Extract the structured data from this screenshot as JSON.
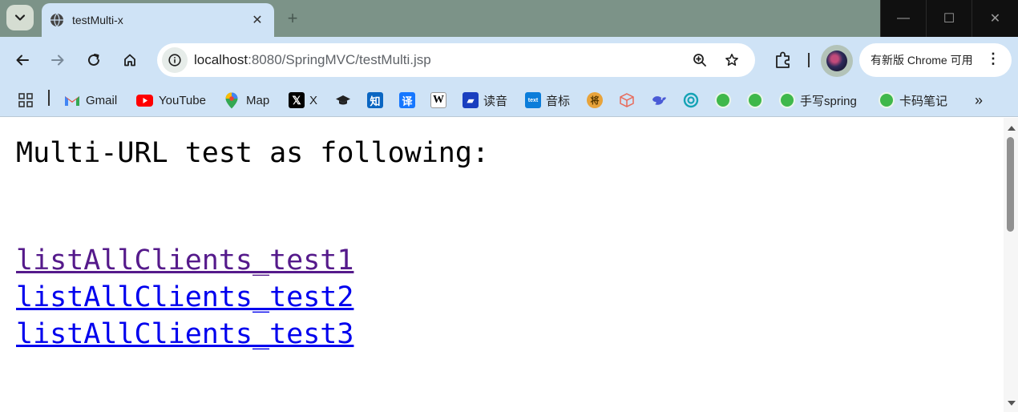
{
  "browser": {
    "tab": {
      "title": "testMulti-x",
      "close_glyph": "✕"
    },
    "new_tab_glyph": "+",
    "window_controls": {
      "minimize": "—",
      "maximize": "☐",
      "close": "✕"
    },
    "omnibox": {
      "url_host": "localhost",
      "url_rest": ":8080/SpringMVC/testMulti.jsp"
    },
    "update_chip": {
      "label": "有新版 Chrome 可用",
      "menu_glyph": "⋮"
    },
    "bookmarks": [
      {
        "label": "",
        "icon": "apps-grid-icon"
      },
      {
        "label": "Gmail",
        "icon": "gmail-icon",
        "color": "#ea4335"
      },
      {
        "label": "YouTube",
        "icon": "youtube-icon",
        "color": "#ff0000"
      },
      {
        "label": "Map",
        "icon": "maps-pin-icon",
        "color": "#34a853"
      },
      {
        "label": "X",
        "icon": "x-icon",
        "color": "#000000"
      },
      {
        "label": "",
        "icon": "graduation-cap-icon",
        "color": "#222222"
      },
      {
        "label": "",
        "icon": "zhihu-icon",
        "color": "#0a66c2"
      },
      {
        "label": "",
        "icon": "translate-icon",
        "color": "#1677ff"
      },
      {
        "label": "",
        "icon": "wikipedia-icon",
        "color": "#ffffff"
      },
      {
        "label": "读音",
        "icon": "flag-icon",
        "color": "#1a3fbf"
      },
      {
        "label": "音标",
        "icon": "textbox-icon",
        "color": "#0b7dda"
      },
      {
        "label": "",
        "icon": "coin-icon",
        "color": "#e8a33a"
      },
      {
        "label": "",
        "icon": "cube-icon",
        "color": "#e86a5a"
      },
      {
        "label": "",
        "icon": "bird-icon",
        "color": "#4a5bd6"
      },
      {
        "label": "",
        "icon": "swirl-icon",
        "color": "#15a3b5"
      },
      {
        "label": "",
        "icon": "leaf-icon",
        "color": "#3fb84a"
      },
      {
        "label": "",
        "icon": "leaf-icon",
        "color": "#3fb84a"
      },
      {
        "label": "手写spring",
        "icon": "leaf-icon",
        "color": "#3fb84a"
      },
      {
        "label": "卡码笔记",
        "icon": "leaf-icon",
        "color": "#3fb84a"
      }
    ],
    "bookmarks_overflow_glyph": "»"
  },
  "page": {
    "heading": "Multi-URL test as following:",
    "links": [
      {
        "label": "listAllClients_test1",
        "state": "visited"
      },
      {
        "label": "listAllClients_test2",
        "state": "unvisited"
      },
      {
        "label": "listAllClients_test3",
        "state": "unvisited"
      }
    ]
  },
  "colors": {
    "frame": "#7c9388",
    "toolbar": "#cfe3f6",
    "link_visited": "#551a8b",
    "link_unvisited": "#0000ee"
  }
}
